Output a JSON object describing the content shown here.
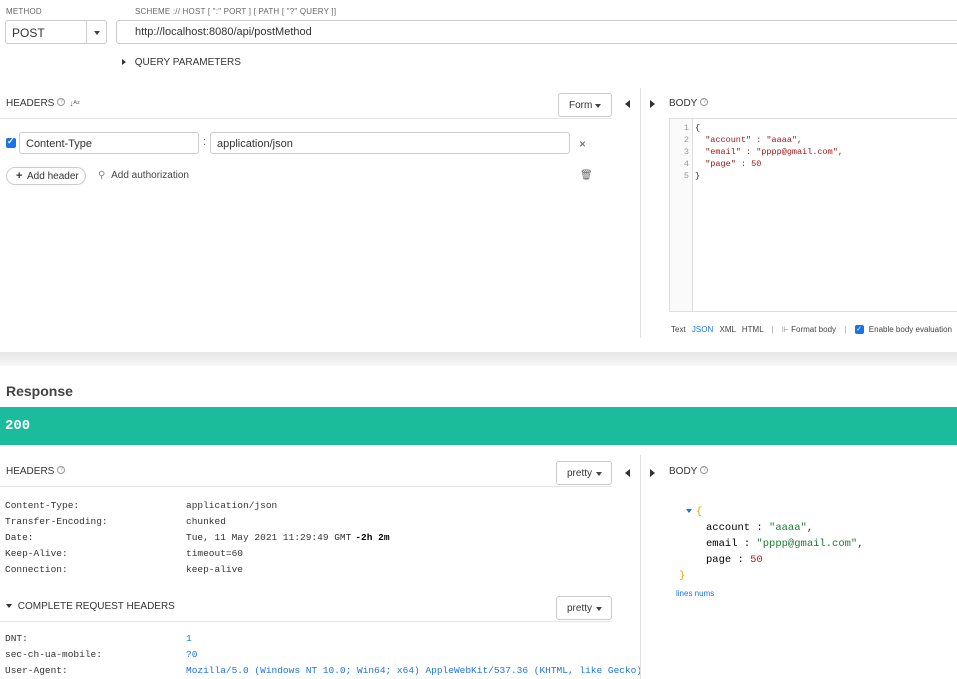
{
  "request": {
    "method_label": "METHOD",
    "method_value": "POST",
    "scheme_label": "SCHEME :// HOST [ \":\" PORT ] [ PATH [ \"?\" QUERY ]]",
    "url": "http://localhost:8080/api/postMethod",
    "query_params_label": "QUERY PARAMETERS",
    "headers_title": "HEADERS",
    "form_button": "Form",
    "header_rows": [
      {
        "name": "Content-Type",
        "value": "application/json",
        "enabled": true
      }
    ],
    "add_header": "Add header",
    "add_authorization": "Add authorization",
    "body_title": "BODY",
    "body_lines": [
      {
        "num": "1",
        "text": "{"
      },
      {
        "num": "2",
        "text": "  \"account\" : \"aaaa\","
      },
      {
        "num": "3",
        "text": "  \"email\" : \"pppp@gmail.com\","
      },
      {
        "num": "4",
        "text": "  \"page\" : 50"
      },
      {
        "num": "5",
        "text": "}"
      }
    ],
    "body_formats": [
      "Text",
      "JSON",
      "XML",
      "HTML"
    ],
    "active_format": "JSON",
    "format_body": "Format body",
    "enable_eval": "Enable body evaluation"
  },
  "response": {
    "title": "Response",
    "status_code": "200",
    "status_color": "#1abc9c",
    "headers_title": "HEADERS",
    "pretty_button": "pretty",
    "headers": [
      {
        "name": "Content-Type:",
        "value": "application/json"
      },
      {
        "name": "Transfer-Encoding:",
        "value": "chunked"
      },
      {
        "name": "Date:",
        "value": "Tue, 11 May 2021 11:29:49 GMT",
        "extra": "-2h 2m"
      },
      {
        "name": "Keep-Alive:",
        "value": "timeout=60"
      },
      {
        "name": "Connection:",
        "value": "keep-alive"
      }
    ],
    "complete_request_label": "COMPLETE REQUEST HEADERS",
    "request_headers": [
      {
        "name": "DNT:",
        "value": "1"
      },
      {
        "name": "sec-ch-ua-mobile:",
        "value": "?0"
      },
      {
        "name": "User-Agent:",
        "value": "Mozilla/5.0 (Windows NT 10.0; Win64; x64) AppleWebKit/537.36 (KHTML, like Gecko)"
      }
    ],
    "body_title": "BODY",
    "json_open": "{",
    "json_close": "}",
    "json_fields": [
      {
        "key": "account",
        "value": "\"aaaa\"",
        "comma": ","
      },
      {
        "key": "email",
        "value": "\"pppp@gmail.com\"",
        "comma": ","
      },
      {
        "key": "page",
        "value": "50",
        "comma": ""
      }
    ],
    "lines_nums": "lines nums"
  }
}
